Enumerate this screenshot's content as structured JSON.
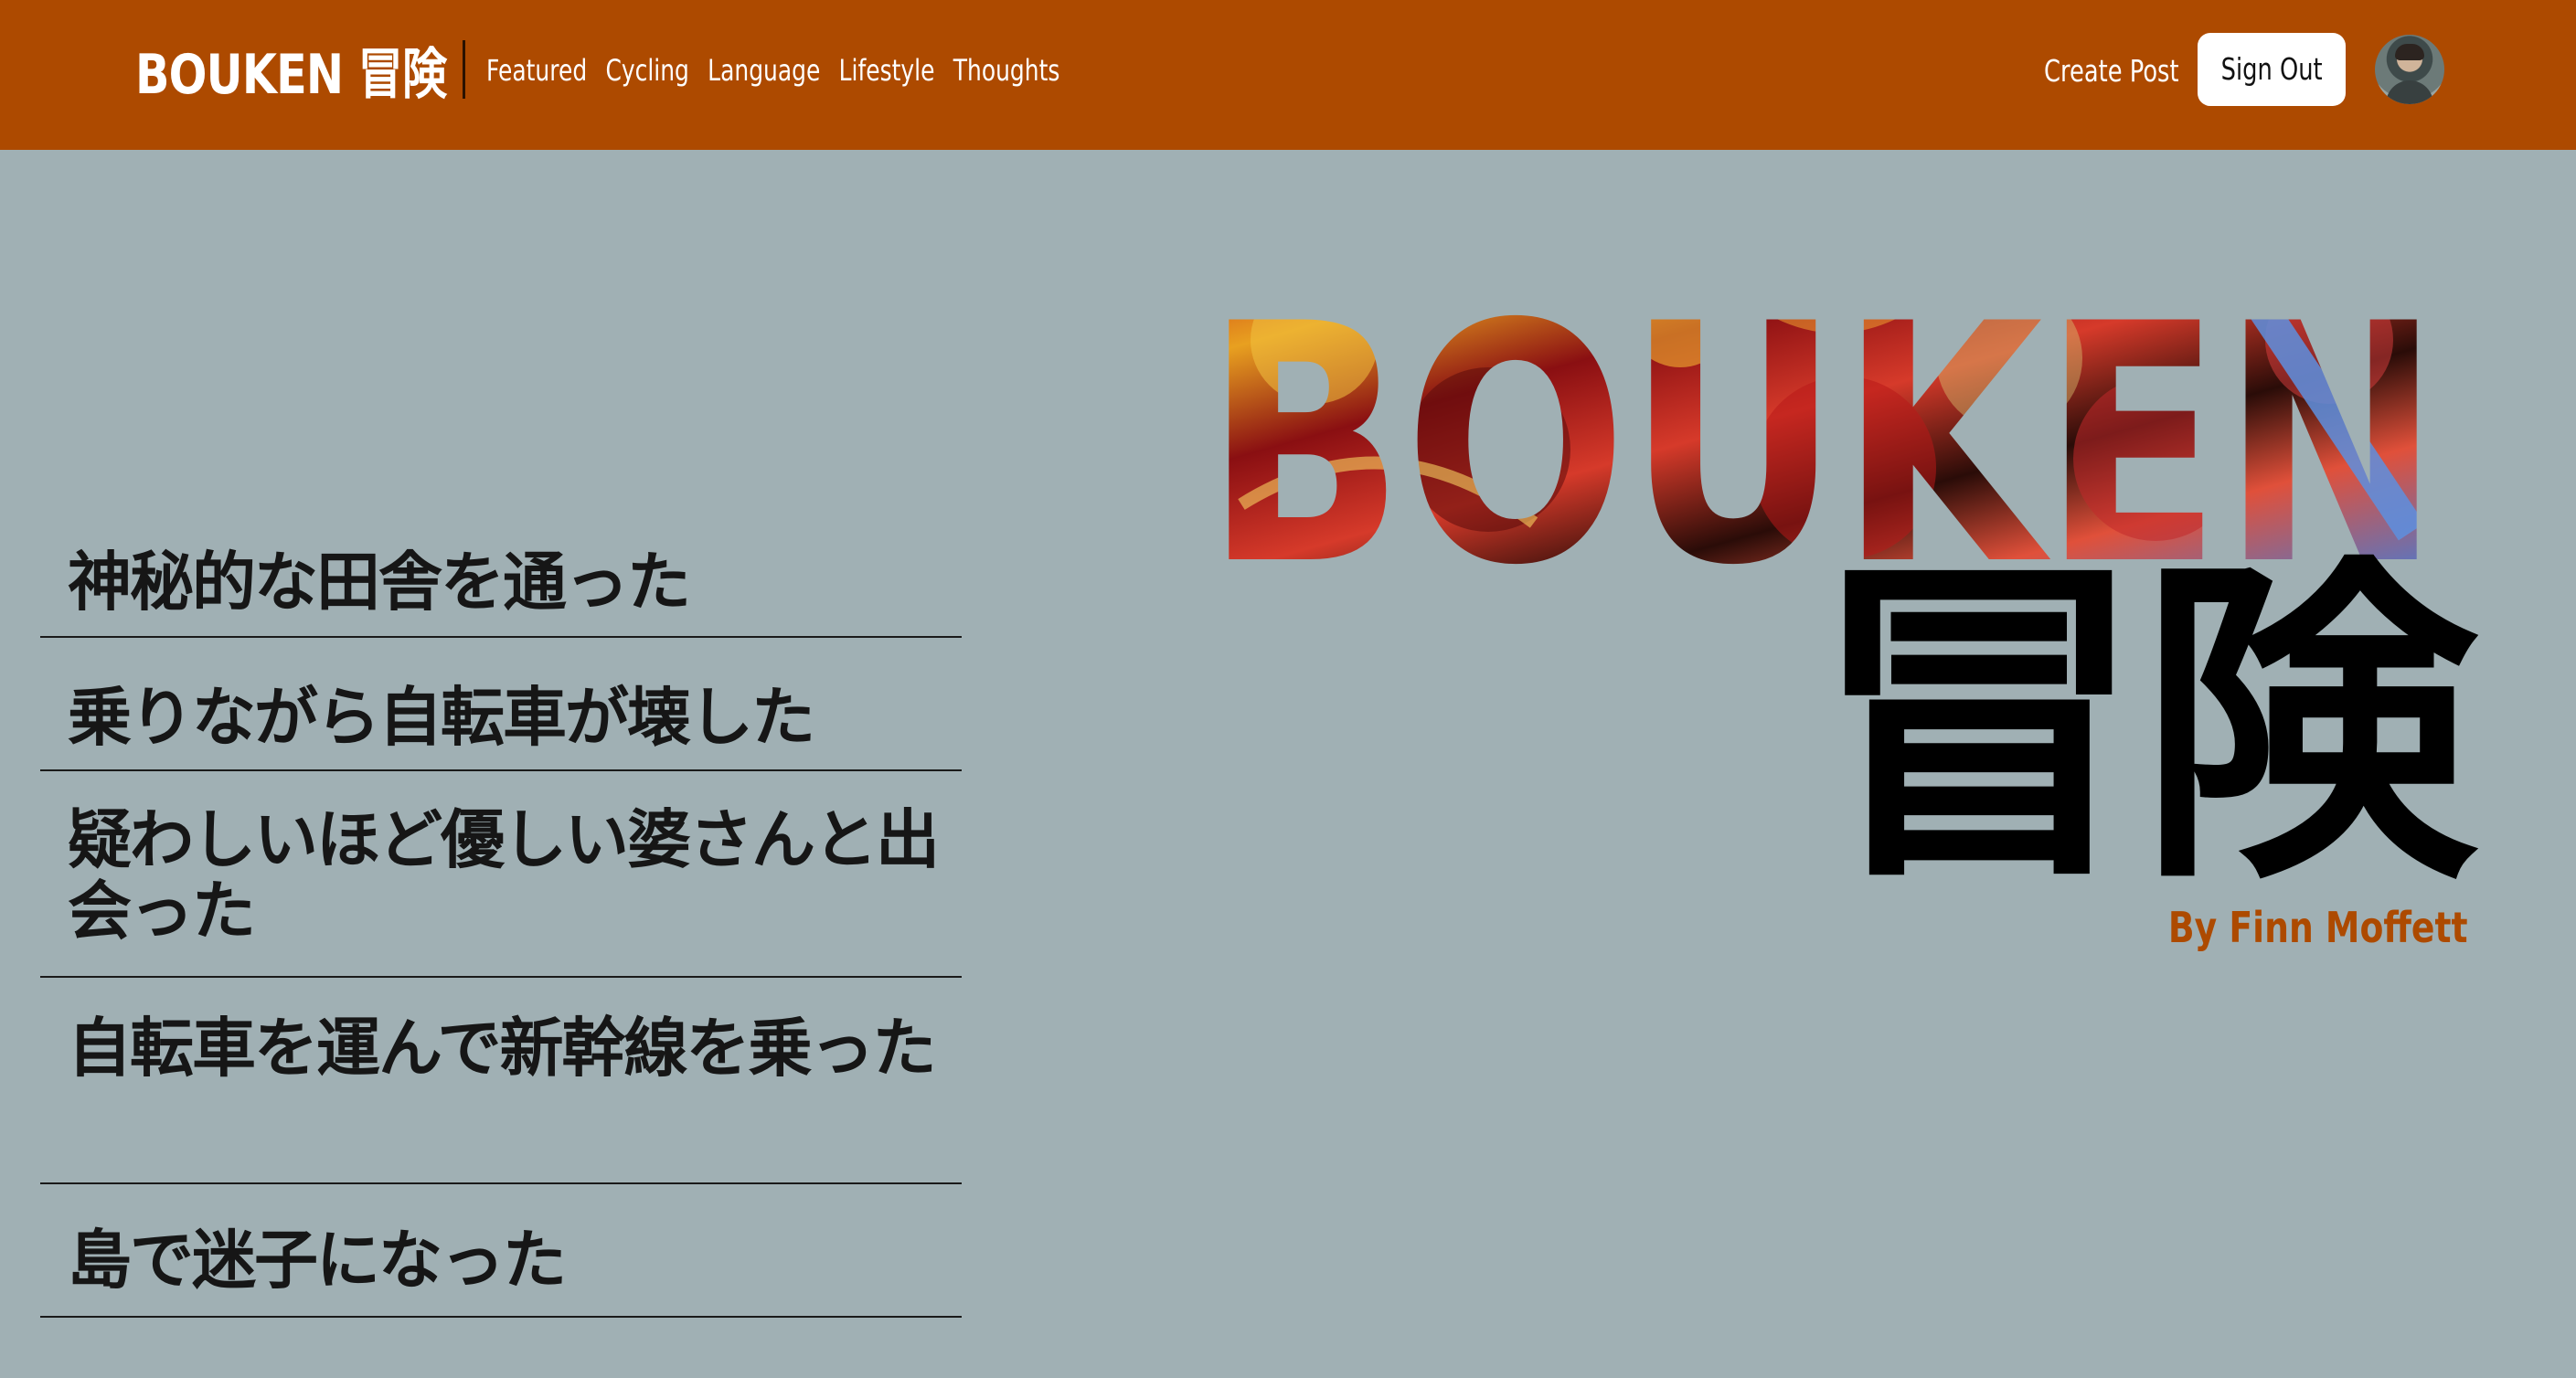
{
  "header": {
    "brand": "BOUKEN 冒険",
    "nav": [
      "Featured",
      "Cycling",
      "Language",
      "Lifestyle",
      "Thoughts"
    ],
    "create_post": "Create Post",
    "sign_out": "Sign Out",
    "brand_color": "#ad4a00"
  },
  "posts": [
    "神秘的な田舎を通った",
    "乗りながら自転車が壊した",
    "疑わしいほど優しい婆さんと出会った",
    "自転車を運んで新幹線を乗った",
    "島で迷子になった"
  ],
  "hero": {
    "title": "BOUKEN",
    "kanji": "冒険",
    "byline": "By Finn Moffett",
    "byline_color": "#ad4a00"
  },
  "colors": {
    "background": "#a0b0b4",
    "header": "#ad4a00"
  }
}
